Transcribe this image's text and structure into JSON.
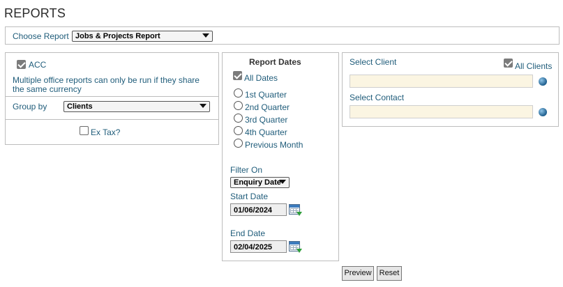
{
  "header": {
    "title": "REPORTS"
  },
  "choose_report": {
    "label": "Choose Report",
    "selected": "Jobs & Projects Report"
  },
  "left_panel": {
    "acc_label": "ACC",
    "acc_checked": true,
    "note": "Multiple office reports can only be run if they share the same currency",
    "group_by_label": "Group by",
    "group_by_selected": "Clients",
    "ex_tax_label": "Ex Tax?",
    "ex_tax_checked": false
  },
  "report_dates": {
    "title": "Report Dates",
    "all_dates_label": "All Dates",
    "all_dates_checked": true,
    "options": [
      "1st Quarter",
      "2nd Quarter",
      "3rd Quarter",
      "4th Quarter",
      "Previous Month"
    ],
    "filter_on_label": "Filter On",
    "filter_on_selected": "Enquiry Date",
    "start_date_label": "Start Date",
    "start_date_value": "01/06/2024",
    "end_date_label": "End Date",
    "end_date_value": "02/04/2025"
  },
  "client_panel": {
    "select_client_label": "Select Client",
    "all_clients_label": "All Clients",
    "all_clients_checked": true,
    "select_contact_label": "Select Contact",
    "client_value": "",
    "contact_value": ""
  },
  "actions": {
    "preview_label": "Preview",
    "reset_label": "Reset"
  },
  "colors": {
    "label_blue": "#1f5c7a",
    "field_bg": "#fbf5e2",
    "border": "#bdbdbd"
  }
}
